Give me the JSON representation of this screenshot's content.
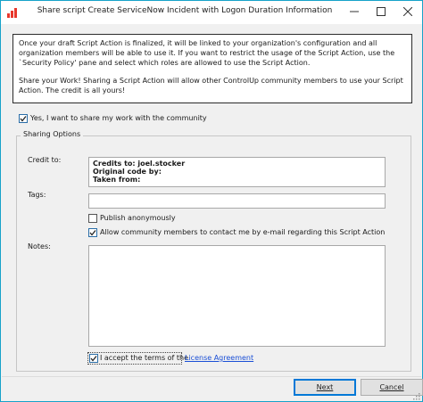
{
  "window": {
    "title": "Share script Create ServiceNow Incident with Logon Duration Information"
  },
  "info": {
    "paragraph1": "Once your draft Script Action is finalized, it will be linked to your organization's configuration and all organization members will be able to use it. If you want to restrict the usage of the Script Action, use the `Security Policy' pane and select which roles are allowed to use the Script Action.",
    "paragraph2": "Share your Work! Sharing a Script Action will allow other ControlUp community members to use your Script Action. The credit is all yours!"
  },
  "share_toggle": {
    "label": "Yes, I want to share my work with the community",
    "checked": true
  },
  "sharing_options": {
    "title": "Sharing Options",
    "credit_label": "Credit to:",
    "credit_lines": [
      "Credits to: joel.stocker",
      "Original code by:",
      "Taken from:"
    ],
    "tags_label": "Tags:",
    "tags_value": "",
    "publish_anon": {
      "label": "Publish anonymously",
      "checked": false
    },
    "allow_contact": {
      "label": "Allow community members to contact me by e-mail regarding this Script Action",
      "checked": true
    },
    "notes_label": "Notes:",
    "notes_value": "",
    "accept": {
      "label": "I accept the terms of the",
      "link": "License Agreement",
      "checked": true
    }
  },
  "buttons": {
    "next_label": "Next",
    "cancel_label": "Cancel"
  },
  "colors": {
    "window_border": "#17a2c9",
    "link": "#1a4fd6",
    "primary_button_border": "#0078d7"
  }
}
